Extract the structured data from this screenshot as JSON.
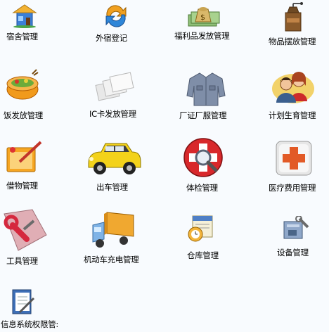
{
  "items": [
    {
      "label": "宿舍管理",
      "icon": "dormitory-house-icon"
    },
    {
      "label": "外宿登记",
      "icon": "refresh-arrows-icon"
    },
    {
      "label": "福利品发放管理",
      "icon": "money-bag-icon"
    },
    {
      "label": "物品摆放管理",
      "icon": "coffee-grinder-icon"
    },
    {
      "label": "饭发放管理",
      "icon": "food-basket-icon"
    },
    {
      "label": "IC卡发放管理",
      "icon": "ic-cards-icon"
    },
    {
      "label": "厂证厂服管理",
      "icon": "work-uniform-icon"
    },
    {
      "label": "计划生育管理",
      "icon": "couple-people-icon"
    },
    {
      "label": "借物管理",
      "icon": "folder-pen-icon"
    },
    {
      "label": "出车管理",
      "icon": "yellow-car-icon"
    },
    {
      "label": "体检管理",
      "icon": "medical-magnifier-icon"
    },
    {
      "label": "医疗费用管理",
      "icon": "medical-cross-icon"
    },
    {
      "label": "工具管理",
      "icon": "tools-wrench-icon"
    },
    {
      "label": "机动车充电管理",
      "icon": "truck-icon"
    },
    {
      "label": "仓库管理",
      "icon": "calendar-clock-icon"
    },
    {
      "label": "设备管理",
      "icon": "equipment-tools-icon"
    },
    {
      "label": "信息系统权限管:",
      "icon": "notebook-pen-icon"
    }
  ]
}
